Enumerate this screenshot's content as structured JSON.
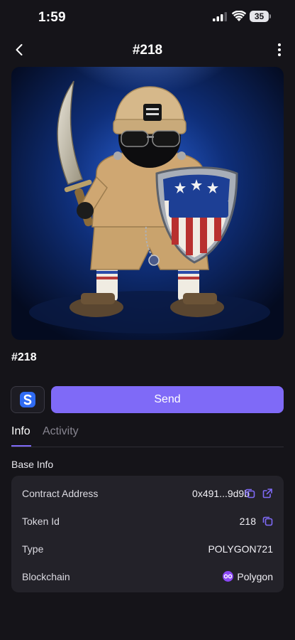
{
  "status_bar": {
    "time": "1:59",
    "battery": "35"
  },
  "nav": {
    "title": "#218"
  },
  "item": {
    "name": "#218"
  },
  "actions": {
    "send_label": "Send",
    "app_icon": "sheep-s-logo-icon"
  },
  "tabs": [
    {
      "label": "Info",
      "active": true
    },
    {
      "label": "Activity",
      "active": false
    }
  ],
  "base_info": {
    "title": "Base Info",
    "rows": [
      {
        "label": "Contract Address",
        "value": "0x491...9d9b"
      },
      {
        "label": "Token Id",
        "value": "218"
      },
      {
        "label": "Type",
        "value": "POLYGON721"
      },
      {
        "label": "Blockchain",
        "value": "Polygon"
      }
    ]
  },
  "colors": {
    "background": "#151419",
    "card": "#232229",
    "accent": "#7f6af7",
    "polygon": "#8a47f5"
  }
}
